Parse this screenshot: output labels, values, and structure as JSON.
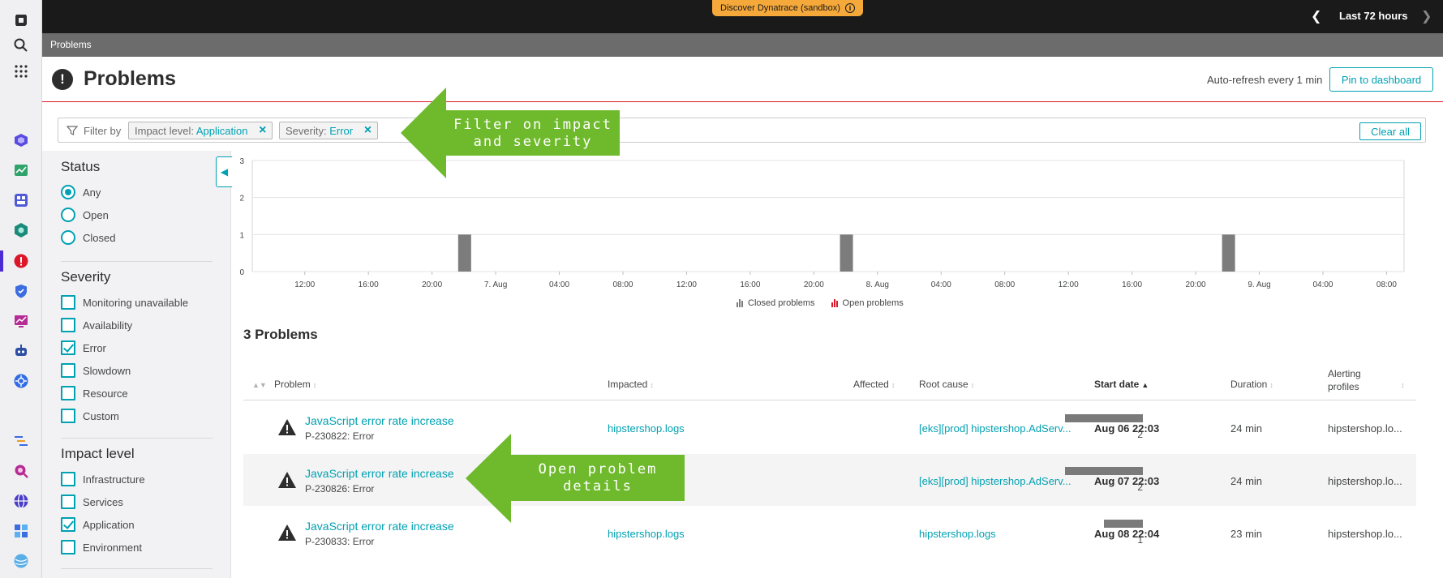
{
  "topbar": {
    "discover_label": "Discover Dynatrace (sandbox)",
    "timeframe": "Last 72 hours"
  },
  "breadcrumb": "Problems",
  "header": {
    "title": "Problems",
    "auto_refresh": "Auto-refresh every 1 min",
    "pin_label": "Pin to dashboard"
  },
  "filterbar": {
    "label": "Filter by",
    "chips": [
      {
        "key": "Impact level: ",
        "value": "Application"
      },
      {
        "key": "Severity: ",
        "value": "Error"
      }
    ],
    "clear_label": "Clear all"
  },
  "filters": {
    "status": {
      "heading": "Status",
      "options": [
        {
          "label": "Any",
          "selected": true
        },
        {
          "label": "Open",
          "selected": false
        },
        {
          "label": "Closed",
          "selected": false
        }
      ]
    },
    "severity": {
      "heading": "Severity",
      "options": [
        {
          "label": "Monitoring unavailable",
          "checked": false
        },
        {
          "label": "Availability",
          "checked": false
        },
        {
          "label": "Error",
          "checked": true
        },
        {
          "label": "Slowdown",
          "checked": false
        },
        {
          "label": "Resource",
          "checked": false
        },
        {
          "label": "Custom",
          "checked": false
        }
      ]
    },
    "impact": {
      "heading": "Impact level",
      "options": [
        {
          "label": "Infrastructure",
          "checked": false
        },
        {
          "label": "Services",
          "checked": false
        },
        {
          "label": "Application",
          "checked": true
        },
        {
          "label": "Environment",
          "checked": false
        }
      ]
    }
  },
  "chart_data": {
    "type": "bar",
    "ylim": [
      0,
      3
    ],
    "y_ticks": [
      "0",
      "1",
      "2",
      "3"
    ],
    "x_ticks": [
      "12:00",
      "16:00",
      "20:00",
      "7. Aug",
      "04:00",
      "08:00",
      "12:00",
      "16:00",
      "20:00",
      "8. Aug",
      "04:00",
      "08:00",
      "12:00",
      "16:00",
      "20:00",
      "9. Aug",
      "04:00",
      "08:00"
    ],
    "series": [
      {
        "name": "Closed problems",
        "color": "#7c7c7c",
        "points": [
          {
            "x": "Aug 06 22:03",
            "y": 1
          },
          {
            "x": "Aug 07 22:03",
            "y": 1
          },
          {
            "x": "Aug 08 22:04",
            "y": 1
          }
        ]
      },
      {
        "name": "Open problems",
        "color": "#dc172a",
        "points": []
      }
    ],
    "legend": [
      "Closed problems",
      "Open problems"
    ],
    "grid": true
  },
  "problems": {
    "count_title": "3 Problems",
    "columns": {
      "problem": "Problem",
      "impacted": "Impacted",
      "affected": "Affected",
      "root_cause": "Root cause",
      "start_date": "Start date",
      "duration": "Duration",
      "alerting_1": "Alerting",
      "alerting_2": "profiles"
    },
    "rows": [
      {
        "title": "JavaScript error rate increase",
        "id": "P-230822: Error",
        "impacted": "hipstershop.logs",
        "affected": 2,
        "affected_text": "2",
        "root_cause": "[eks][prod] hipstershop.AdServ...",
        "start": "Aug 06 22:03",
        "duration": "24 min",
        "alerting": "hipstershop.lo..."
      },
      {
        "title": "JavaScript error rate increase",
        "id": "P-230826: Error",
        "impacted": "",
        "affected": 2,
        "affected_text": "2",
        "root_cause": "[eks][prod] hipstershop.AdServ...",
        "start": "Aug 07 22:03",
        "duration": "24 min",
        "alerting": "hipstershop.lo..."
      },
      {
        "title": "JavaScript error rate increase",
        "id": "P-230833: Error",
        "impacted": "hipstershop.logs",
        "affected": 1,
        "affected_text": "1",
        "root_cause": "hipstershop.logs",
        "start": "Aug 08 22:04",
        "duration": "23 min",
        "alerting": "hipstershop.lo..."
      }
    ]
  },
  "callouts": {
    "filter_line1": "Filter on impact",
    "filter_line2": "and severity",
    "details_line1": "Open problem",
    "details_line2": "details"
  },
  "colors": {
    "accent": "#00a1b2",
    "callout": "#6fba2c",
    "open_problem": "#dc172a"
  }
}
